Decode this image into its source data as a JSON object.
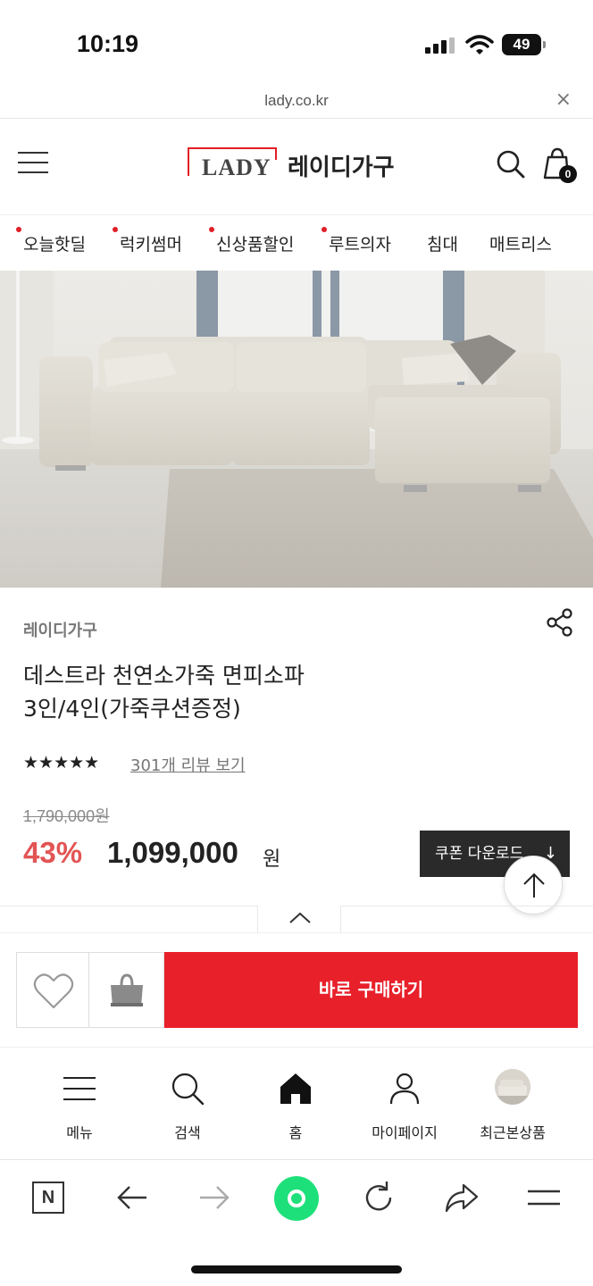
{
  "status_bar": {
    "time": "10:19",
    "battery": "49"
  },
  "browser": {
    "url": "lady.co.kr",
    "close_glyph": "×"
  },
  "header": {
    "logo_latin": "LADY",
    "logo_korean": "레이디가구",
    "cart_count": "0",
    "icons": [
      "hamburger-menu-icon",
      "search-icon",
      "cart-icon"
    ]
  },
  "categories": [
    {
      "label": "오늘핫딜",
      "dot": true
    },
    {
      "label": "럭키썸머",
      "dot": true
    },
    {
      "label": "신상품할인",
      "dot": true
    },
    {
      "label": "루트의자",
      "dot": true
    },
    {
      "label": "침대",
      "dot": false
    },
    {
      "label": "매트리스",
      "dot": false
    }
  ],
  "product": {
    "brand": "레이디가구",
    "title_line1": "데스트라 천연소가죽 면피소파",
    "title_line2": "3인/4인(가죽쿠션증정)",
    "rating": 5,
    "stars": "★★★★★",
    "review_link": "301개 리뷰 보기",
    "original_price": "1,790,000원",
    "discount": "43%",
    "sale_price": "1,099,000",
    "currency": "원",
    "coupon_label": "쿠폰 다운로드",
    "coupon_arrow": "↓"
  },
  "purchase": {
    "buy_label": "바로 구매하기"
  },
  "bottom_nav": [
    {
      "label": "메뉴",
      "icon": "menu-icon"
    },
    {
      "label": "검색",
      "icon": "search-icon"
    },
    {
      "label": "홈",
      "icon": "home-icon"
    },
    {
      "label": "마이페이지",
      "icon": "person-icon"
    },
    {
      "label": "최근본상품",
      "icon": "recent-product-thumbnail"
    }
  ],
  "browser_toolbar": {
    "naver_letter": "N",
    "icons": [
      "naver-icon",
      "back-arrow-icon",
      "forward-arrow-icon",
      "green-action-icon",
      "reload-icon",
      "share-arrow-icon",
      "menu-lines-icon"
    ]
  },
  "colors": {
    "accent_red": "#e8202a",
    "discount_red": "#e35454",
    "coupon_dark": "#2a2a2a",
    "green_action": "#1ee07a"
  }
}
